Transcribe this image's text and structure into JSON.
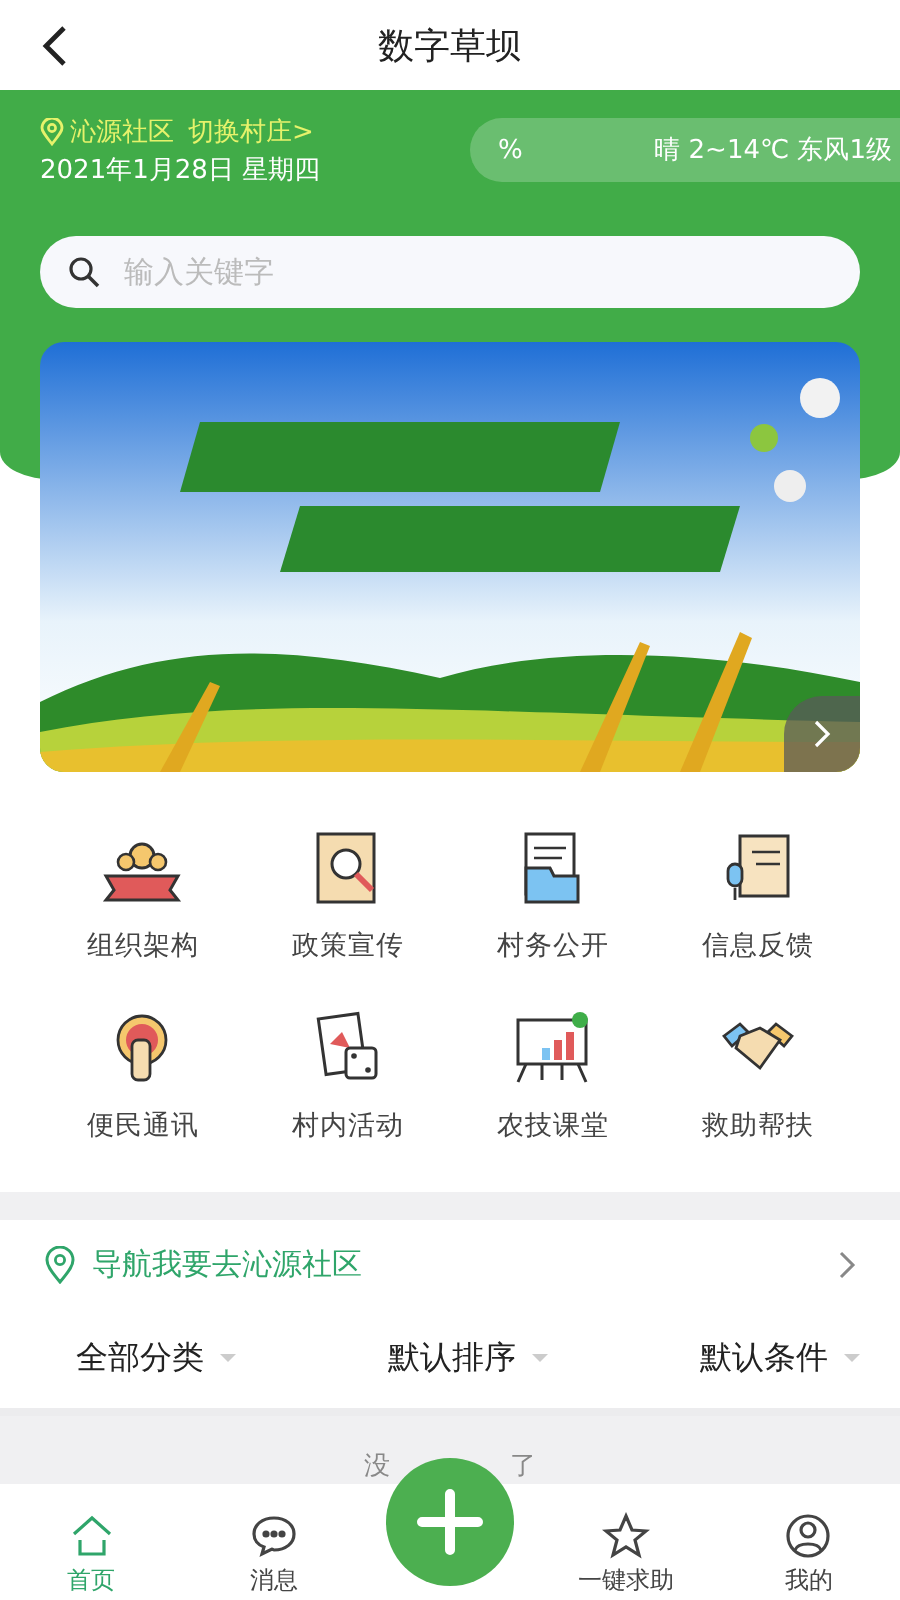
{
  "title_bar": {
    "title": "数字草坝"
  },
  "header": {
    "location": "沁源社区",
    "switch_link": "切换村庄>",
    "date": "2021年1月28日 星期四",
    "weather": [
      "%",
      "晴 2~14℃ 东风1级"
    ]
  },
  "search": {
    "placeholder": "输入关键字"
  },
  "banner": {
    "kind": "picture"
  },
  "grid": [
    {
      "label": "组织架构"
    },
    {
      "label": "政策宣传"
    },
    {
      "label": "村务公开"
    },
    {
      "label": "信息反馈"
    },
    {
      "label": "便民通讯"
    },
    {
      "label": "村内活动"
    },
    {
      "label": "农技课堂"
    },
    {
      "label": "救助帮扶"
    }
  ],
  "navigation": {
    "label": "导航我要去沁源社区"
  },
  "filters": [
    {
      "label": "全部分类"
    },
    {
      "label": "默认排序"
    },
    {
      "label": "默认条件"
    }
  ],
  "list_end": [
    "没",
    "了"
  ],
  "bottom_nav": [
    {
      "label": "首页",
      "selected": true
    },
    {
      "label": "消息",
      "selected": false
    },
    {
      "label": "一键求助",
      "selected": false
    },
    {
      "label": "我的",
      "selected": false
    }
  ]
}
